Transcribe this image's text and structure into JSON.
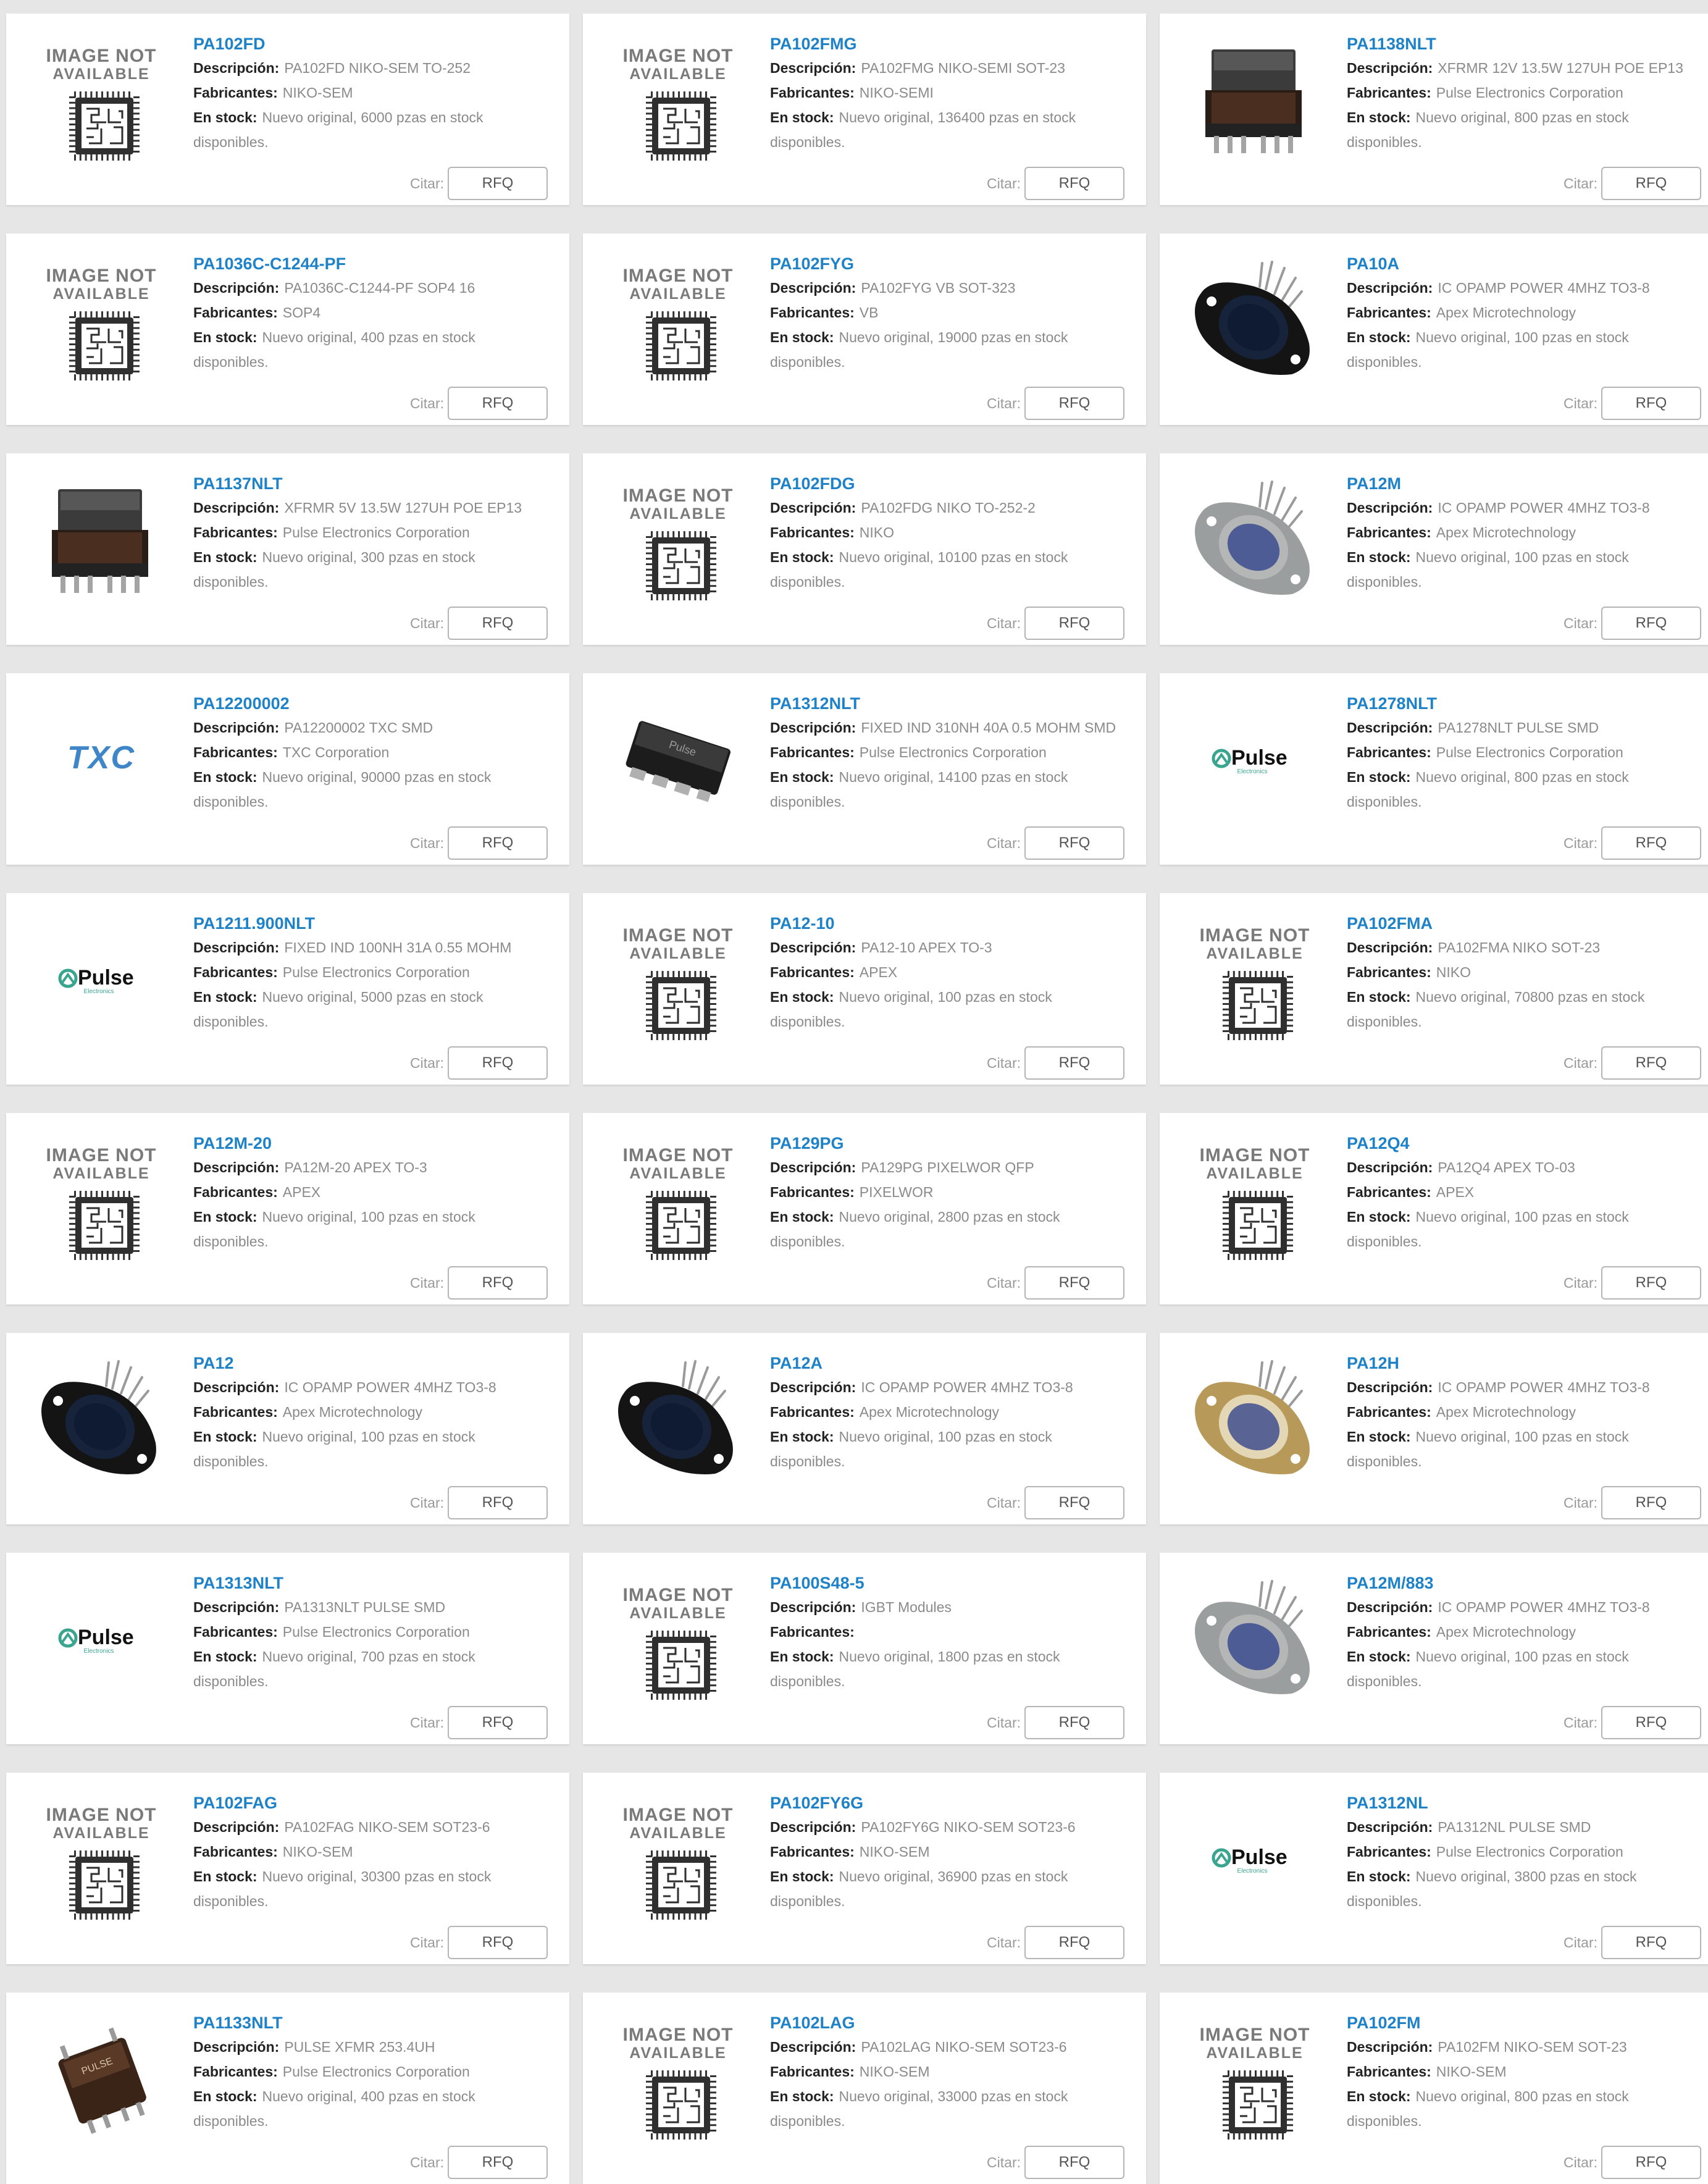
{
  "labels": {
    "descripcion": "Descripción:",
    "fabricantes": "Fabricantes:",
    "en_stock": "En stock:",
    "disponibles": "disponibles.",
    "citar": "Citar:",
    "rfq": "RFQ"
  },
  "image_placeholder": {
    "line1": "IMAGE NOT",
    "line2": "AVAILABLE"
  },
  "products": [
    {
      "pn": "PA102FD",
      "desc": "PA102FD NIKO-SEM TO-252",
      "mfr": "NIKO-SEM",
      "stock": "Nuevo original, 6000 pzas en stock",
      "image": "not-available"
    },
    {
      "pn": "PA102FMG",
      "desc": "PA102FMG NIKO-SEMI SOT-23",
      "mfr": "NIKO-SEMI",
      "stock": "Nuevo original, 136400 pzas en stock",
      "image": "not-available"
    },
    {
      "pn": "PA1138NLT",
      "desc": "XFRMR 12V 13.5W 127UH POE EP13",
      "mfr": "Pulse Electronics Corporation",
      "stock": "Nuevo original, 800 pzas en stock",
      "image": "transformer"
    },
    {
      "pn": "PA1036C-C1244-PF",
      "desc": "PA1036C-C1244-PF SOP4 16",
      "mfr": "SOP4",
      "stock": "Nuevo original, 400 pzas en stock",
      "image": "not-available"
    },
    {
      "pn": "PA102FYG",
      "desc": "PA102FYG VB SOT-323",
      "mfr": "VB",
      "stock": "Nuevo original, 19000 pzas en stock",
      "image": "not-available"
    },
    {
      "pn": "PA10A",
      "desc": "IC OPAMP POWER 4MHZ TO3-8",
      "mfr": "Apex Microtechnology",
      "stock": "Nuevo original, 100 pzas en stock",
      "image": "to3-black"
    },
    {
      "pn": "PA1137NLT",
      "desc": "XFRMR 5V 13.5W 127UH POE EP13",
      "mfr": "Pulse Electronics Corporation",
      "stock": "Nuevo original, 300 pzas en stock",
      "image": "transformer"
    },
    {
      "pn": "PA102FDG",
      "desc": "PA102FDG NIKO TO-252-2",
      "mfr": "NIKO",
      "stock": "Nuevo original, 10100 pzas en stock",
      "image": "not-available"
    },
    {
      "pn": "PA12M",
      "desc": "IC OPAMP POWER 4MHZ TO3-8",
      "mfr": "Apex Microtechnology",
      "stock": "Nuevo original, 100 pzas en stock",
      "image": "to3-silver"
    },
    {
      "pn": "PA12200002",
      "desc": "PA12200002 TXC SMD",
      "mfr": "TXC Corporation",
      "stock": "Nuevo original, 90000 pzas en stock",
      "image": "txc-logo"
    },
    {
      "pn": "PA1312NLT",
      "desc": "FIXED IND 310NH 40A 0.5 MOHM SMD",
      "mfr": "Pulse Electronics Corporation",
      "stock": "Nuevo original, 14100 pzas en stock",
      "image": "smd-inductor"
    },
    {
      "pn": "PA1278NLT",
      "desc": "PA1278NLT PULSE SMD",
      "mfr": "Pulse Electronics Corporation",
      "stock": "Nuevo original, 800 pzas en stock",
      "image": "pulse-logo"
    },
    {
      "pn": "PA1211.900NLT",
      "desc": "FIXED IND 100NH 31A 0.55 MOHM",
      "mfr": "Pulse Electronics Corporation",
      "stock": "Nuevo original, 5000 pzas en stock",
      "image": "pulse-logo"
    },
    {
      "pn": "PA12-10",
      "desc": "PA12-10 APEX TO-3",
      "mfr": "APEX",
      "stock": "Nuevo original, 100 pzas en stock",
      "image": "not-available"
    },
    {
      "pn": "PA102FMA",
      "desc": "PA102FMA NIKO SOT-23",
      "mfr": "NIKO",
      "stock": "Nuevo original, 70800 pzas en stock",
      "image": "not-available"
    },
    {
      "pn": "PA12M-20",
      "desc": "PA12M-20 APEX TO-3",
      "mfr": "APEX",
      "stock": "Nuevo original, 100 pzas en stock",
      "image": "not-available"
    },
    {
      "pn": "PA129PG",
      "desc": "PA129PG PIXELWOR QFP",
      "mfr": "PIXELWOR",
      "stock": "Nuevo original, 2800 pzas en stock",
      "image": "not-available"
    },
    {
      "pn": "PA12Q4",
      "desc": "PA12Q4 APEX TO-03",
      "mfr": "APEX",
      "stock": "Nuevo original, 100 pzas en stock",
      "image": "not-available"
    },
    {
      "pn": "PA12",
      "desc": "IC OPAMP POWER 4MHZ TO3-8",
      "mfr": "Apex Microtechnology",
      "stock": "Nuevo original, 100 pzas en stock",
      "image": "to3-black"
    },
    {
      "pn": "PA12A",
      "desc": "IC OPAMP POWER 4MHZ TO3-8",
      "mfr": "Apex Microtechnology",
      "stock": "Nuevo original, 100 pzas en stock",
      "image": "to3-black"
    },
    {
      "pn": "PA12H",
      "desc": "IC OPAMP POWER 4MHZ TO3-8",
      "mfr": "Apex Microtechnology",
      "stock": "Nuevo original, 100 pzas en stock",
      "image": "to3-gold"
    },
    {
      "pn": "PA1313NLT",
      "desc": "PA1313NLT PULSE SMD",
      "mfr": "Pulse Electronics Corporation",
      "stock": "Nuevo original, 700 pzas en stock",
      "image": "pulse-logo"
    },
    {
      "pn": "PA100S48-5",
      "desc": "IGBT Modules",
      "mfr": "",
      "stock": "Nuevo original, 1800 pzas en stock",
      "image": "not-available"
    },
    {
      "pn": "PA12M/883",
      "desc": "IC OPAMP POWER 4MHZ TO3-8",
      "mfr": "Apex Microtechnology",
      "stock": "Nuevo original, 100 pzas en stock",
      "image": "to3-silver"
    },
    {
      "pn": "PA102FAG",
      "desc": "PA102FAG NIKO-SEM SOT23-6",
      "mfr": "NIKO-SEM",
      "stock": "Nuevo original, 30300 pzas en stock",
      "image": "not-available"
    },
    {
      "pn": "PA102FY6G",
      "desc": "PA102FY6G NIKO-SEM SOT23-6",
      "mfr": "NIKO-SEM",
      "stock": "Nuevo original, 36900 pzas en stock",
      "image": "not-available"
    },
    {
      "pn": "PA1312NL",
      "desc": "PA1312NL PULSE SMD",
      "mfr": "Pulse Electronics Corporation",
      "stock": "Nuevo original, 3800 pzas en stock",
      "image": "pulse-logo"
    },
    {
      "pn": "PA1133NLT",
      "desc": "PULSE XFMR 253.4UH",
      "mfr": "Pulse Electronics Corporation",
      "stock": "Nuevo original, 400 pzas en stock",
      "image": "transformer-small"
    },
    {
      "pn": "PA102LAG",
      "desc": "PA102LAG NIKO-SEM SOT23-6",
      "mfr": "NIKO-SEM",
      "stock": "Nuevo original, 33000 pzas en stock",
      "image": "not-available"
    },
    {
      "pn": "PA102FM",
      "desc": "PA102FM NIKO-SEM SOT-23",
      "mfr": "NIKO-SEM",
      "stock": "Nuevo original, 800 pzas en stock",
      "image": "not-available"
    }
  ],
  "logos": {
    "txc": "TXC",
    "pulse": "Pulse",
    "pulse_sub": "Electronics"
  },
  "colors": {
    "part_number": "#1e82c8",
    "page_bg": "#e6e6e6",
    "card_bg": "#ffffff",
    "muted_text": "#8a8a8a",
    "pulse_teal": "#3aa58f",
    "txc_blue": "#3e86c7"
  }
}
